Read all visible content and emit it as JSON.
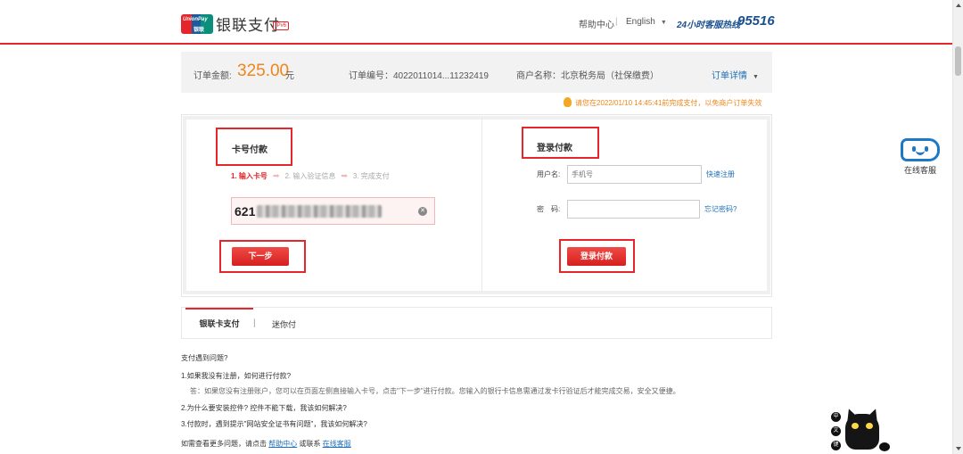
{
  "header": {
    "logo": {
      "top_text": "UnionPay",
      "bottom_text": "银联"
    },
    "brand_name": "银联支付",
    "ipv6_badge": "IPv6",
    "help_center": "帮助中心",
    "separator": "|",
    "language": "English",
    "hotline_label": "24小时客服热线",
    "hotline_number": "95516"
  },
  "order": {
    "amount_label": "订单金额:",
    "amount": "325.00",
    "currency": "元",
    "order_no": "订单编号：4022011014...11232419",
    "merchant": "商户名称：北京税务局（社保缴费）",
    "details_link": "订单详情"
  },
  "warning": "请您在2022/01/10 14:45:41前完成支付，以免商户订单失效",
  "card_pay": {
    "title": "卡号付款",
    "steps": [
      "1. 输入卡号",
      "2. 输入验证信息",
      "3. 完成支付"
    ],
    "card_prefix": "621",
    "next_button": "下一步"
  },
  "login_pay": {
    "title": "登录付款",
    "username_label": "用户名:",
    "username_placeholder": "手机号",
    "quick_register": "快速注册",
    "password_label": "密　码:",
    "forgot_password": "忘记密码?",
    "login_button": "登录付款"
  },
  "tabs": {
    "active": "银联卡支付",
    "separator": "|",
    "other": "迷你付"
  },
  "faq": {
    "heading": "支付遇到问题?",
    "q1": "1.如果我没有注册，如何进行付款?",
    "a1": "答：如果您没有注册账户，您可以在页面左侧直接输入卡号，点击\"下一步\"进行付款。您输入的银行卡信息需通过发卡行验证后才能完成交易，安全又便捷。",
    "q2": "2.为什么要安装控件? 控件不能下载，我该如何解决?",
    "q3": "3.付款时，遇到提示\"网站安全证书有问题\"，我该如何解决?",
    "more_prefix": "如需查看更多问题，请点击",
    "help_link": "帮助中心",
    "or_contact": "或联系",
    "service_link": "在线客服"
  },
  "service_widget": {
    "label": "在线客服"
  },
  "mascot": {
    "badges": [
      "中",
      "文",
      "键"
    ]
  },
  "colors": {
    "accent_red": "#e5262b",
    "amount_orange": "#f08519",
    "link_blue": "#1e6fb8",
    "hotline_blue": "#1c4f8e"
  },
  "icons": {
    "service": "customer-service-face-icon",
    "warning": "bulb-icon",
    "clear": "clear-circle-icon",
    "mascot": "black-cat-mascot"
  }
}
